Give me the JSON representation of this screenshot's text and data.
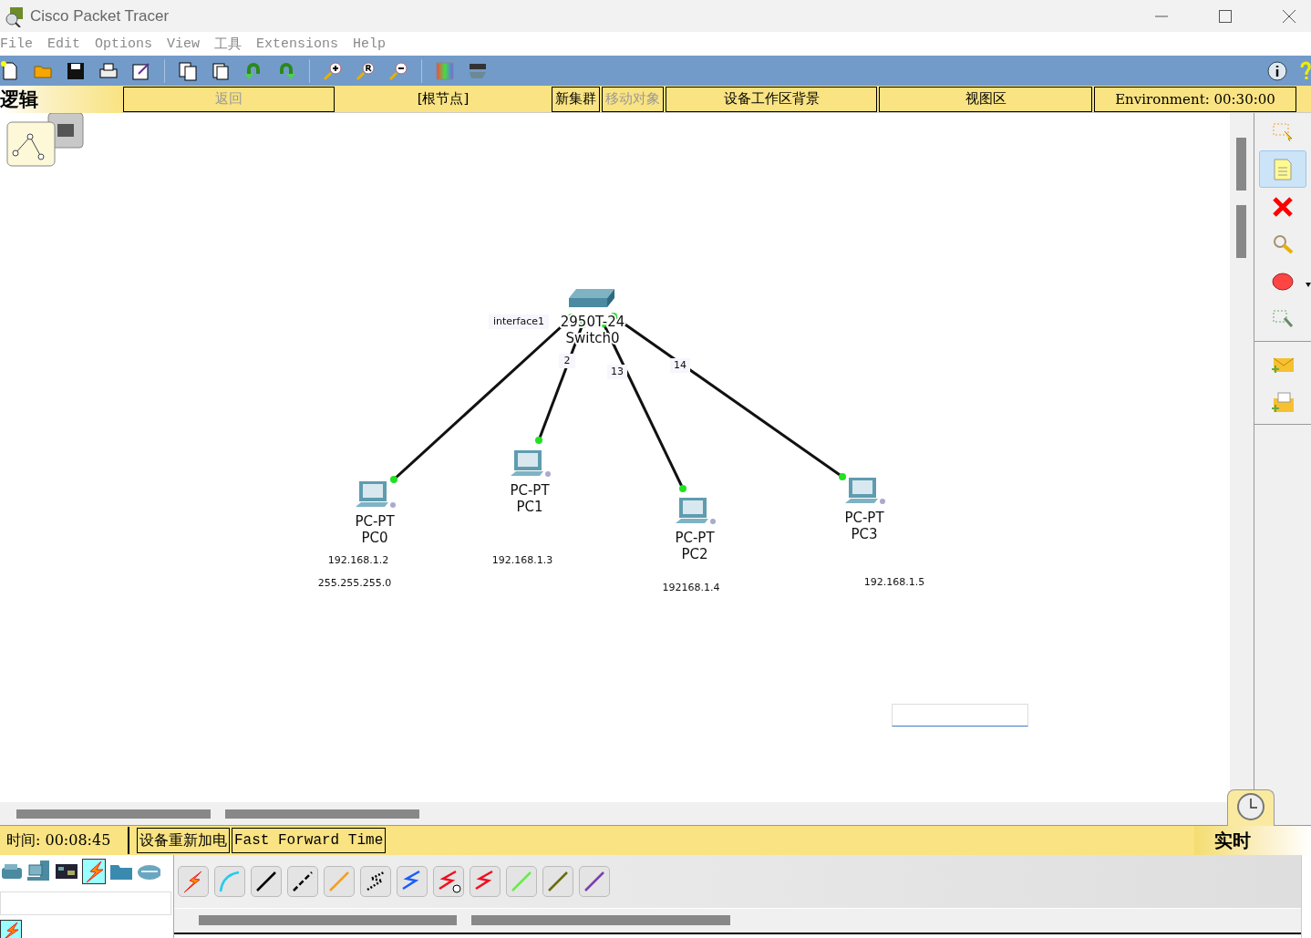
{
  "window": {
    "title": "Cisco Packet Tracer"
  },
  "menu": [
    "File",
    "Edit",
    "Options",
    "View",
    "工具",
    "Extensions",
    "Help"
  ],
  "workspace_bar": {
    "mode": "逻辑",
    "buttons": [
      {
        "kind": "wide",
        "label": "返回",
        "disabled": true
      },
      {
        "kind": "plain",
        "label": "[根节点]",
        "disabled": false
      },
      {
        "kind": "narrow",
        "label": "新集群",
        "disabled": false
      },
      {
        "kind": "narrow",
        "label": "移动对象",
        "disabled": true
      },
      {
        "kind": "wide",
        "label": "设备工作区背景",
        "disabled": false
      },
      {
        "kind": "wide",
        "label": "视图区",
        "disabled": false
      },
      {
        "kind": "wide",
        "label": "Environment: 00:30:00",
        "disabled": false
      }
    ]
  },
  "topology": {
    "switch": {
      "model": "2950T-24",
      "name": "Switch0"
    },
    "pcs": [
      {
        "model": "PC-PT",
        "name": "PC0"
      },
      {
        "model": "PC-PT",
        "name": "PC1"
      },
      {
        "model": "PC-PT",
        "name": "PC2"
      },
      {
        "model": "PC-PT",
        "name": "PC3"
      }
    ],
    "port_labels": [
      "interface1",
      "2",
      "13",
      "14"
    ],
    "notes": [
      "192.168.1.2",
      "255.255.255.0",
      "192.168.1.3",
      "192168.1.4",
      "192.168.1.5"
    ]
  },
  "tools": [
    {
      "kind": "select",
      "selected": false
    },
    {
      "kind": "note",
      "selected": true
    },
    {
      "kind": "delete",
      "selected": false
    },
    {
      "kind": "inspect",
      "selected": false
    },
    {
      "kind": "shape",
      "selected": false
    },
    {
      "kind": "resize",
      "selected": false
    },
    {
      "kind": "simple-pdu",
      "selected": false
    },
    {
      "kind": "complex-pdu",
      "selected": false
    }
  ],
  "status_bar": {
    "time": "时间: 00:08:45",
    "buttons": [
      "设备重新加电",
      "Fast Forward Time"
    ],
    "mode": "实时"
  },
  "device_categories": [
    {
      "kind": "network",
      "selected": false
    },
    {
      "kind": "end",
      "selected": false
    },
    {
      "kind": "component",
      "selected": false
    },
    {
      "kind": "connection",
      "selected": true
    },
    {
      "kind": "misc",
      "selected": false
    },
    {
      "kind": "cloud",
      "selected": false
    }
  ]
}
